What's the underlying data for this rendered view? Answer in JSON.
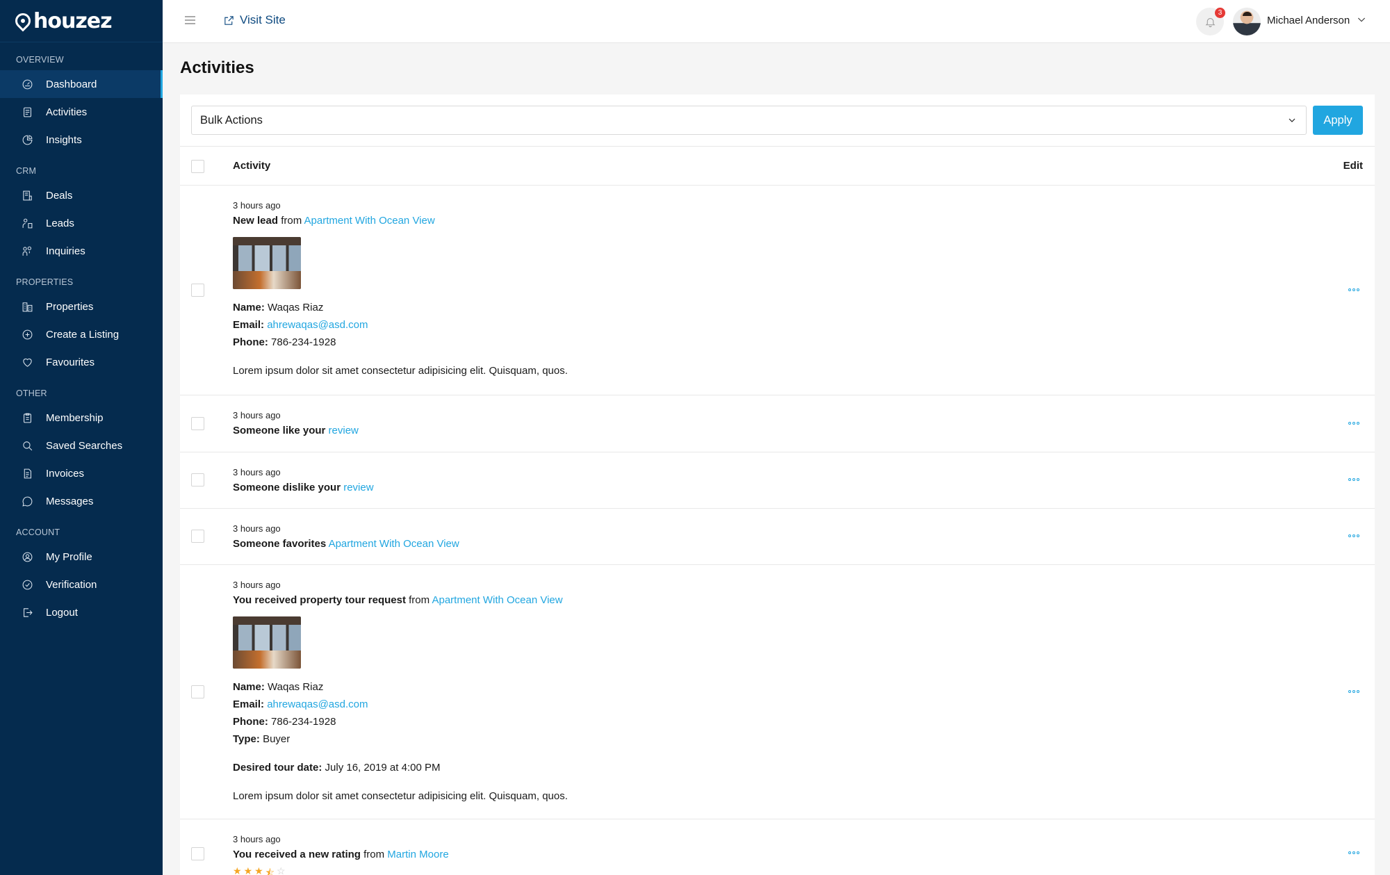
{
  "brand": {
    "name": "houzez"
  },
  "sidebar": {
    "sections": [
      {
        "title": "OVERVIEW",
        "items": [
          {
            "label": "Dashboard",
            "icon": "dashboard-icon",
            "active": true
          },
          {
            "label": "Activities",
            "icon": "activities-icon"
          },
          {
            "label": "Insights",
            "icon": "insights-icon"
          }
        ]
      },
      {
        "title": "CRM",
        "items": [
          {
            "label": "Deals",
            "icon": "deals-icon"
          },
          {
            "label": "Leads",
            "icon": "leads-icon"
          },
          {
            "label": "Inquiries",
            "icon": "inquiries-icon"
          }
        ]
      },
      {
        "title": "PROPERTIES",
        "items": [
          {
            "label": "Properties",
            "icon": "properties-icon"
          },
          {
            "label": "Create a Listing",
            "icon": "plus-circle-icon"
          },
          {
            "label": "Favourites",
            "icon": "heart-icon"
          }
        ]
      },
      {
        "title": "OTHER",
        "items": [
          {
            "label": "Membership",
            "icon": "membership-icon"
          },
          {
            "label": "Saved Searches",
            "icon": "search-icon"
          },
          {
            "label": "Invoices",
            "icon": "invoice-icon"
          },
          {
            "label": "Messages",
            "icon": "message-icon"
          }
        ]
      },
      {
        "title": "ACCOUNT",
        "items": [
          {
            "label": "My Profile",
            "icon": "user-icon"
          },
          {
            "label": "Verification",
            "icon": "check-circle-icon"
          },
          {
            "label": "Logout",
            "icon": "logout-icon"
          }
        ]
      }
    ]
  },
  "topbar": {
    "visit_site": "Visit Site",
    "notifications_count": "3",
    "user_name": "Michael Anderson"
  },
  "page": {
    "title": "Activities"
  },
  "bulk": {
    "select_label": "Bulk Actions",
    "apply_label": "Apply"
  },
  "table": {
    "col_activity": "Activity",
    "col_edit": "Edit"
  },
  "activities": [
    {
      "time": "3 hours ago",
      "title_bold": "New lead",
      "title_rest": " from ",
      "link": "Apartment With Ocean View",
      "name_label": "Name:",
      "name": " Waqas Riaz",
      "email_label": "Email:",
      "email": "ahrewaqas@asd.com",
      "phone_label": "Phone:",
      "phone": " 786-234-1928",
      "message": "Lorem ipsum dolor sit amet consectetur adipisicing elit. Quisquam, quos."
    },
    {
      "time": "3 hours ago",
      "title_bold": "Someone like your",
      "title_rest": " ",
      "link": "review"
    },
    {
      "time": "3 hours ago",
      "title_bold": "Someone dislike your",
      "title_rest": " ",
      "link": "review"
    },
    {
      "time": "3 hours ago",
      "title_bold": "Someone favorites",
      "title_rest": " ",
      "link": "Apartment With Ocean View"
    },
    {
      "time": "3 hours ago",
      "title_bold": "You received property tour request",
      "title_rest": " from ",
      "link": "Apartment With Ocean View",
      "name_label": "Name:",
      "name": " Waqas Riaz",
      "email_label": "Email:",
      "email": "ahrewaqas@asd.com",
      "phone_label": "Phone:",
      "phone": " 786-234-1928",
      "type_label": "Type:",
      "type": " Buyer",
      "tour_label": "Desired tour date:",
      "tour": " July 16, 2019 at 4:00 PM",
      "message": "Lorem ipsum dolor sit amet consectetur adipisicing elit. Quisquam, quos."
    },
    {
      "time": "3 hours ago",
      "title_bold": "You received a new rating",
      "title_rest": " from ",
      "link": "Martin Moore",
      "rating": 3.5
    }
  ],
  "colors": {
    "sidebar_bg": "#052b4e",
    "accent": "#21a6e0",
    "badge": "#e53935"
  }
}
